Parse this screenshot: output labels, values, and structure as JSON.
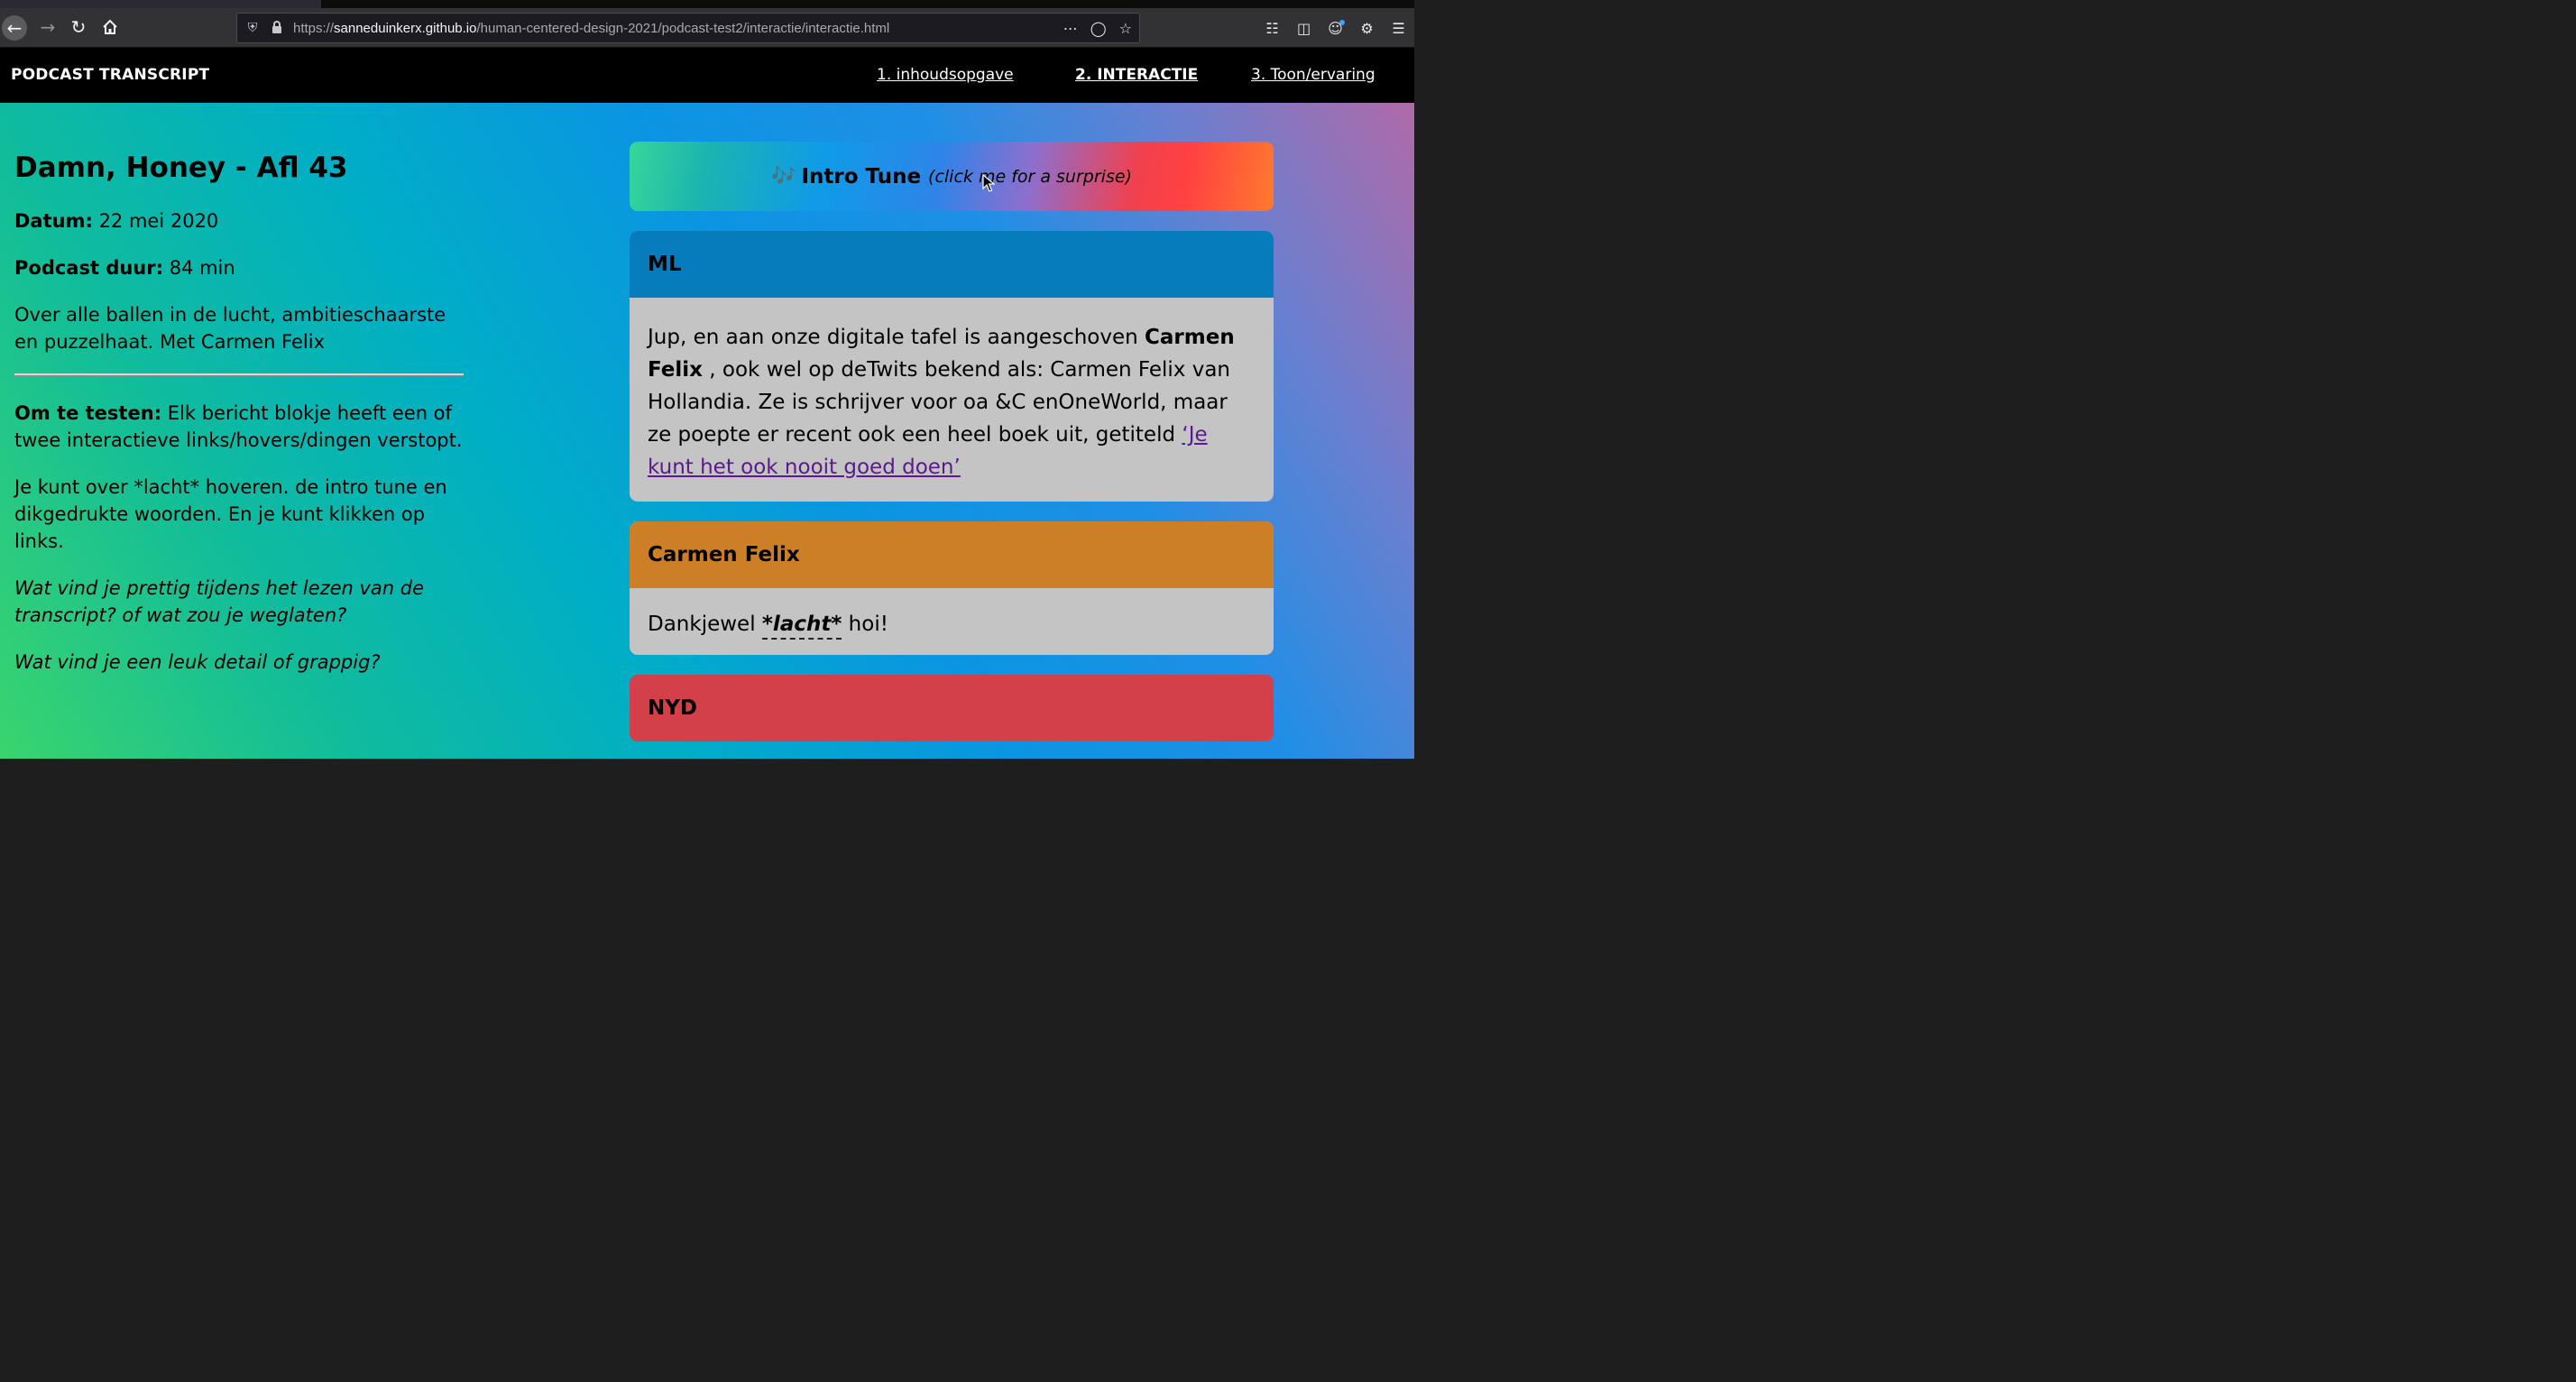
{
  "browser": {
    "url_scheme": "https://",
    "url_host": "sanneduinkerx.github.io",
    "url_path": "/human-centered-design-2021/podcast-test2/interactie/interactie.html"
  },
  "nav": {
    "brand": "PODCAST TRANSCRIPT",
    "links": [
      "1. inhoudsopgave",
      "2. INTERACTIE",
      "3. Toon/ervaring"
    ]
  },
  "episode": {
    "title": "Damn, Honey - Afl 43",
    "date_label": "Datum:",
    "date_value": "22 mei 2020",
    "duration_label": "Podcast duur:",
    "duration_value": "84 min",
    "description": "Over alle ballen in de lucht, ambitieschaarste en puzzelhaat. Met Carmen Felix",
    "test_label": "Om te testen:",
    "test_text": "Elk bericht blokje heeft een of twee interactieve links/hovers/dingen verstopt.",
    "hover_text": "Je kunt over *lacht* hoveren. de intro tune en dikgedrukte woorden. En je kunt klikken op links.",
    "question_1": "Wat vind je prettig tijdens het lezen van de transcript? of wat zou je weglaten?",
    "question_2": "Wat vind je een leuk detail of grappig?"
  },
  "intro": {
    "note": "🎶",
    "title": "Intro Tune",
    "hint": "(click me for a surprise)"
  },
  "messages": {
    "ml": {
      "speaker": "ML",
      "t1": "Jup, en aan onze digitale tafel is aangeschoven ",
      "bold": "Carmen Felix",
      "t2": " , ook wel op deTwits bekend als: Carmen Felix van Hollandia. Ze is schrijver voor oa &C enOneWorld, maar ze poepte er recent ook een heel boek uit, getiteld ",
      "link": "‘Je kunt het ook nooit goed doen’"
    },
    "cf": {
      "speaker": "Carmen Felix",
      "t1": "Dankjewel ",
      "laugh": "*lacht*",
      "t2": " hoi!"
    },
    "nyd": {
      "speaker": "NYD"
    }
  },
  "colors": {
    "ml_header": "#067cbd",
    "cf_header": "#cc7f26",
    "nyd_header": "#d4404a",
    "message_body": "#c4c4c4",
    "link": "#5b1a8c"
  }
}
